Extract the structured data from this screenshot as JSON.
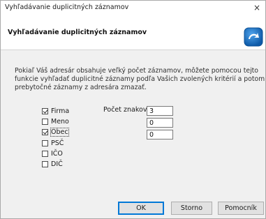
{
  "window": {
    "title": "Vyhľadávanie duplicitných záznamov",
    "close_glyph": "×"
  },
  "header": {
    "title": "Vyhľadávanie duplicitných záznamov",
    "icon": "blue-arrow-icon",
    "icon_color": "#1e73be"
  },
  "description": {
    "lines": [
      "Pokiaľ Váš adresár obsahuje veľký počet záznamov, môžete pomocou tejto",
      "funkcie vyhľadať duplicitné záznamy podľa Vašich zvolených kritérií a potom",
      "prebytočné záznamy z adresára zmazať."
    ]
  },
  "criteria": [
    {
      "label": "Firma",
      "checked": true
    },
    {
      "label": "Meno",
      "checked": false
    },
    {
      "label": "Obec",
      "checked": true
    },
    {
      "label": "PSČ",
      "checked": false
    },
    {
      "label": "IČO",
      "checked": false
    },
    {
      "label": "DIČ",
      "checked": false
    }
  ],
  "char_count": {
    "label": "Počet znakov",
    "values": [
      "3",
      "0",
      "0"
    ]
  },
  "buttons": {
    "ok": "OK",
    "cancel": "Storno",
    "help": "Pomocník"
  }
}
